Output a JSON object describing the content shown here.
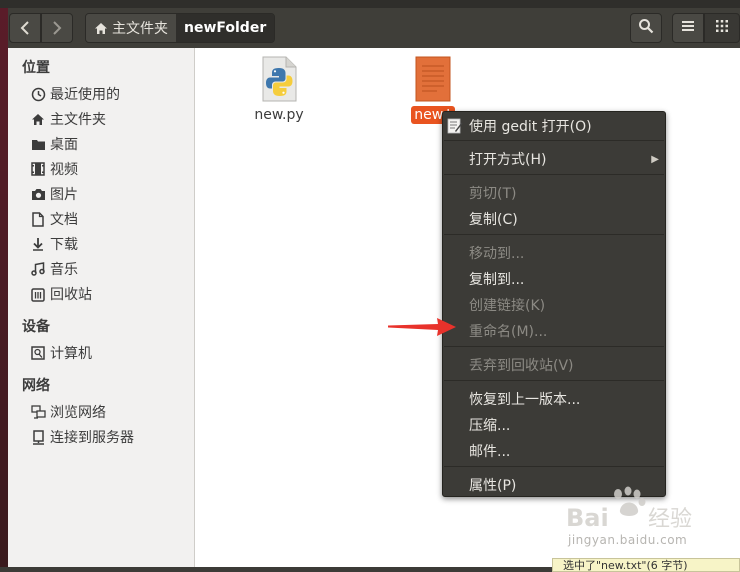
{
  "header": {
    "back_icon": "chevron-left-icon",
    "forward_icon": "chevron-right-icon",
    "breadcrumbs": [
      {
        "label": "主文件夹",
        "icon": "home-icon"
      },
      {
        "label": "newFolder"
      }
    ],
    "search_icon": "search-icon",
    "list_icon": "list-view-icon",
    "grid_icon": "grid-view-icon"
  },
  "sidebar": {
    "sections": [
      {
        "title": "位置",
        "items": [
          {
            "label": "最近使用的",
            "icon": "clock-icon"
          },
          {
            "label": "主文件夹",
            "icon": "home-icon"
          },
          {
            "label": "桌面",
            "icon": "folder-icon"
          },
          {
            "label": "视频",
            "icon": "film-icon"
          },
          {
            "label": "图片",
            "icon": "camera-icon"
          },
          {
            "label": "文档",
            "icon": "document-icon"
          },
          {
            "label": "下载",
            "icon": "download-icon"
          },
          {
            "label": "音乐",
            "icon": "music-icon"
          },
          {
            "label": "回收站",
            "icon": "trash-icon"
          }
        ]
      },
      {
        "title": "设备",
        "items": [
          {
            "label": "计算机",
            "icon": "drive-icon"
          }
        ]
      },
      {
        "title": "网络",
        "items": [
          {
            "label": "浏览网络",
            "icon": "network-icon"
          },
          {
            "label": "连接到服务器",
            "icon": "server-icon"
          }
        ]
      }
    ]
  },
  "files": [
    {
      "name": "new.py",
      "icon": "python-file-icon",
      "selected": false
    },
    {
      "name": "new.txt",
      "visible_label": "new.t",
      "icon": "text-file-icon",
      "selected": true
    }
  ],
  "context_menu": {
    "items": [
      {
        "label": "使用 gedit 打开(O)",
        "enabled": true,
        "icon": "gedit-icon"
      },
      {
        "label": "打开方式(H)",
        "enabled": true,
        "submenu": true
      },
      {
        "label": "剪切(T)",
        "enabled": false
      },
      {
        "label": "复制(C)",
        "enabled": true
      },
      {
        "label": "移动到...",
        "enabled": false
      },
      {
        "label": "复制到...",
        "enabled": true
      },
      {
        "label": "创建链接(K)",
        "enabled": false
      },
      {
        "label": "重命名(M)...",
        "enabled": false
      },
      {
        "label": "丢弃到回收站(V)",
        "enabled": false
      },
      {
        "label": "恢复到上一版本...",
        "enabled": true
      },
      {
        "label": "压缩...",
        "enabled": true
      },
      {
        "label": "邮件...",
        "enabled": true
      },
      {
        "label": "属性(P)",
        "enabled": true
      }
    ]
  },
  "annotation": {
    "icon": "red-arrow-icon",
    "color": "#e8322b"
  },
  "watermark": {
    "brand": "Baidu经验",
    "url": "jingyan.baidu.com"
  },
  "tooltip": {
    "text": "选中了\"new.txt\"(6 字节)"
  },
  "colors": {
    "accent": "#e95420",
    "menu_bg": "#3c3b37",
    "sidebar_bg": "#f2f1f0"
  }
}
